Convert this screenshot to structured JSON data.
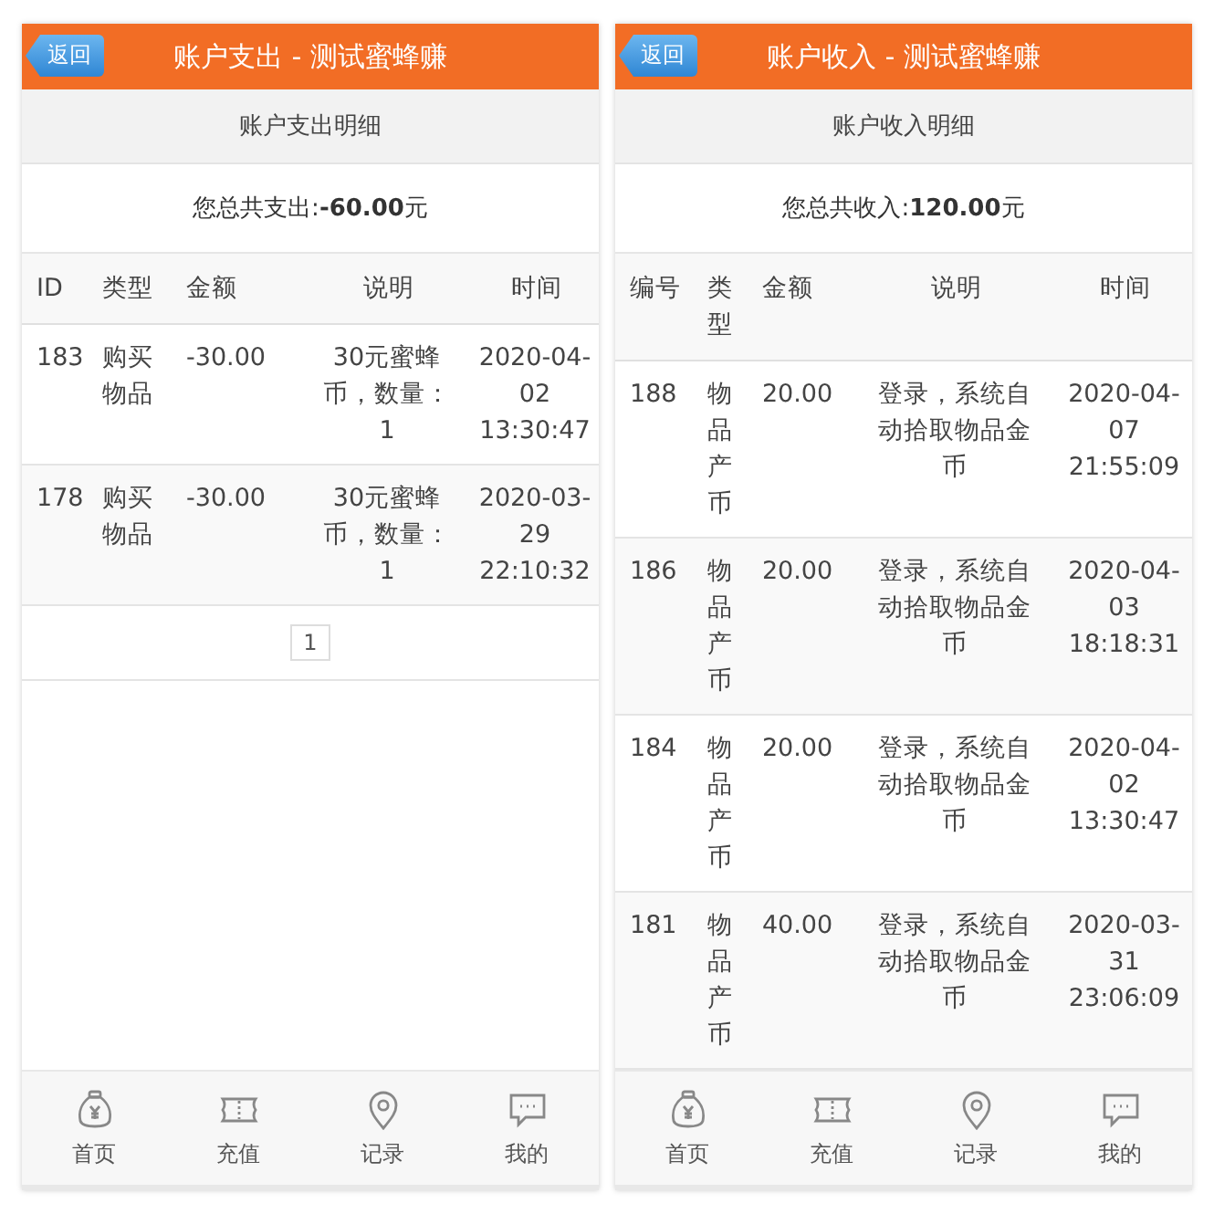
{
  "panels": [
    {
      "back_button": "返回",
      "title": "账户支出 - 测试蜜蜂赚",
      "subtitle": "账户支出明细",
      "total_label": "您总共支出: ",
      "total_value": "-60.00",
      "total_unit": "元",
      "columns": [
        "ID",
        "类型",
        "金额",
        "说明",
        "时间"
      ],
      "rows": [
        {
          "cells": [
            "183",
            "购买物品",
            "-30.00",
            "30元蜜蜂币，数量：1",
            "2020-04-02 13:30:47"
          ]
        },
        {
          "cells": [
            "178",
            "购买物品",
            "-30.00",
            "30元蜜蜂币，数量：1",
            "2020-03-29 22:10:32"
          ]
        }
      ],
      "pager": {
        "page": "1"
      },
      "nav": [
        {
          "label": "首页",
          "kind": "bag"
        },
        {
          "label": "充值",
          "kind": "ticket"
        },
        {
          "label": "记录",
          "kind": "pin"
        },
        {
          "label": "我的",
          "kind": "chat"
        }
      ]
    },
    {
      "back_button": "返回",
      "title": "账户收入 - 测试蜜蜂赚",
      "subtitle": "账户收入明细",
      "total_label": "您总共收入: ",
      "total_value": "120.00",
      "total_unit": "元",
      "columns": [
        "编号",
        "类型",
        "金额",
        "说明",
        "时间"
      ],
      "rows": [
        {
          "cells": [
            "188",
            "物品产币",
            "20.00",
            "登录，系统自动拾取物品金币",
            "2020-04-07 21:55:09"
          ]
        },
        {
          "cells": [
            "186",
            "物品产币",
            "20.00",
            "登录，系统自动拾取物品金币",
            "2020-04-03 18:18:31"
          ]
        },
        {
          "cells": [
            "184",
            "物品产币",
            "20.00",
            "登录，系统自动拾取物品金币",
            "2020-04-02 13:30:47"
          ]
        },
        {
          "cells": [
            "181",
            "物品产币",
            "40.00",
            "登录，系统自动拾取物品金币",
            "2020-03-31 23:06:09"
          ]
        }
      ],
      "nav": [
        {
          "label": "首页",
          "kind": "bag"
        },
        {
          "label": "充值",
          "kind": "ticket"
        },
        {
          "label": "记录",
          "kind": "pin"
        },
        {
          "label": "我的",
          "kind": "chat"
        }
      ]
    }
  ]
}
